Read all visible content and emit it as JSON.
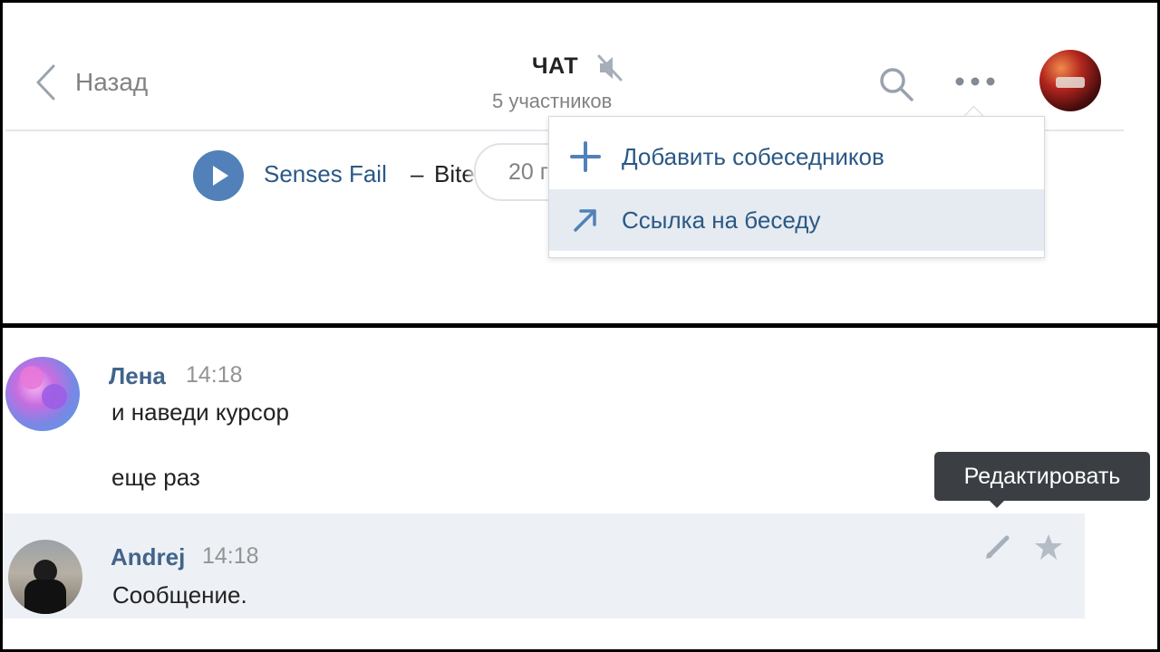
{
  "header": {
    "back_label": "Назад",
    "chat_title": "ЧАТ",
    "participants": "5 участников"
  },
  "player": {
    "artist": "Senses Fail",
    "dash": "–",
    "title": "Bite",
    "pill_text": "20 г"
  },
  "menu": {
    "items": [
      {
        "label": "Добавить собеседников",
        "icon": "plus-icon"
      },
      {
        "label": "Ссылка на беседу",
        "icon": "link-arrow-icon"
      }
    ]
  },
  "messages": [
    {
      "author": "Лена",
      "time": "14:18",
      "lines": [
        "и наведи курсор",
        "еще раз"
      ]
    },
    {
      "author": "Andrej",
      "time": "14:18",
      "lines": [
        "Сообщение."
      ]
    }
  ],
  "tooltip": {
    "text": "Редактировать"
  },
  "colors": {
    "accent": "#5181b8",
    "link": "#2a5885",
    "author": "#42648b",
    "muted": "#828282",
    "highlight_row": "#edf0f5",
    "menu_hover": "#e5ebf1",
    "tooltip_bg": "#3b3f44"
  }
}
